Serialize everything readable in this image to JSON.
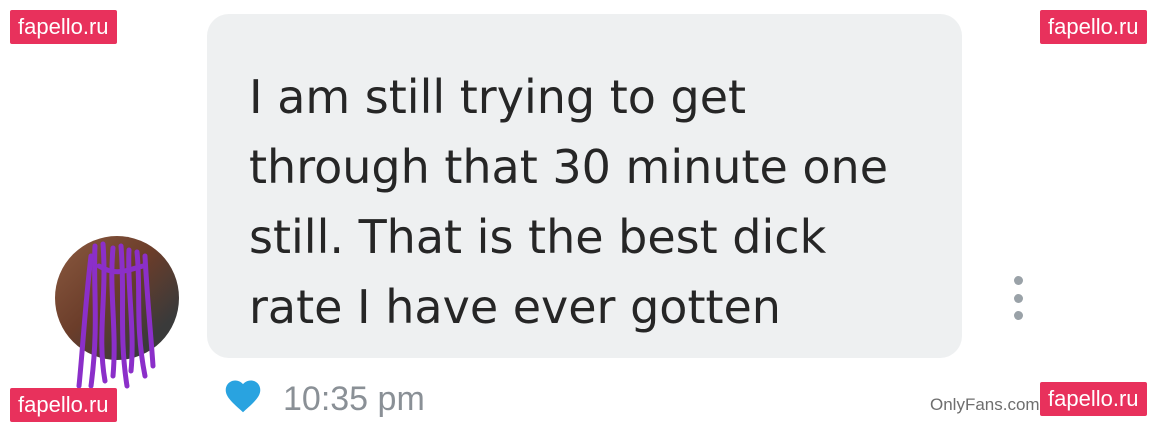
{
  "watermarks": {
    "top_left": "fapello.ru",
    "top_right": "fapello.ru",
    "bottom_left": "fapello.ru",
    "bottom_right": "fapello.ru"
  },
  "message": {
    "text": "I am still trying to get\nthrough that 30 minute one\nstill. That is the best dick\nrate I have ever gotten",
    "time": "10:35 pm",
    "liked": true
  },
  "footer": {
    "credit": "OnlyFans.com"
  },
  "colors": {
    "watermark_bg": "#e8315c",
    "bubble_bg": "#eef0f1",
    "heart": "#29a3e0",
    "timestamp": "#8a9096"
  },
  "icons": {
    "like": "heart-icon",
    "menu": "more-vertical-icon"
  }
}
